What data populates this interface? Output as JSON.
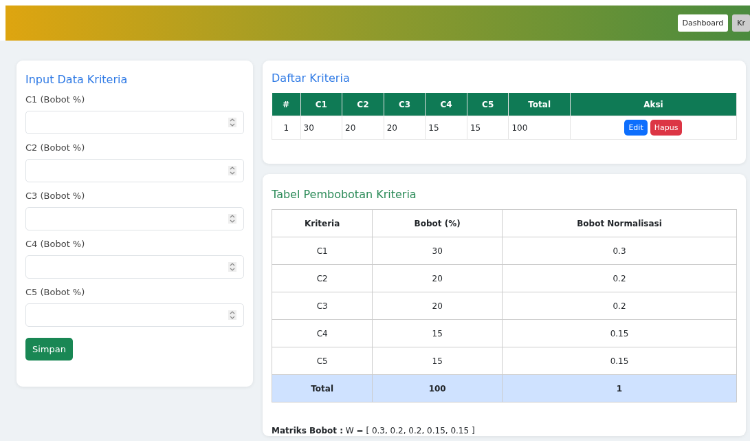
{
  "navbar": {
    "buttons": [
      {
        "label": "Dashboard",
        "selected": false
      },
      {
        "label": "Kr",
        "selected": true
      }
    ]
  },
  "input_form": {
    "title": "Input Data Kriteria",
    "fields": [
      {
        "label": "C1 (Bobot %)"
      },
      {
        "label": "C2 (Bobot %)"
      },
      {
        "label": "C3 (Bobot %)"
      },
      {
        "label": "C4 (Bobot %)"
      },
      {
        "label": "C5 (Bobot %)"
      }
    ],
    "submit": "Simpan"
  },
  "criteria_list": {
    "title": "Daftar Kriteria",
    "columns": [
      "#",
      "C1",
      "C2",
      "C3",
      "C4",
      "C5",
      "Total",
      "Aksi"
    ],
    "rows": [
      {
        "cells": [
          "1",
          "30",
          "20",
          "20",
          "15",
          "15",
          "100"
        ],
        "actions": [
          {
            "label": "Edit",
            "kind": "edit"
          },
          {
            "label": "Hapus",
            "kind": "delete"
          }
        ]
      }
    ]
  },
  "weights_table": {
    "title": "Tabel Pembobotan Kriteria",
    "columns": [
      "Kriteria",
      "Bobot (%)",
      "Bobot Normalisasi"
    ],
    "rows": [
      {
        "cells": [
          "C1",
          "30",
          "0.3"
        ],
        "kind": "data"
      },
      {
        "cells": [
          "C2",
          "20",
          "0.2"
        ],
        "kind": "data"
      },
      {
        "cells": [
          "C3",
          "20",
          "0.2"
        ],
        "kind": "data"
      },
      {
        "cells": [
          "C4",
          "15",
          "0.15"
        ],
        "kind": "data"
      },
      {
        "cells": [
          "C5",
          "15",
          "0.15"
        ],
        "kind": "data"
      },
      {
        "cells": [
          "Total",
          "100",
          "1"
        ],
        "kind": "total"
      }
    ],
    "matrix": "**Matriks Bobot :** W = [ 0.3, 0.2, 0.2, 0.15, 0.15 ]"
  }
}
